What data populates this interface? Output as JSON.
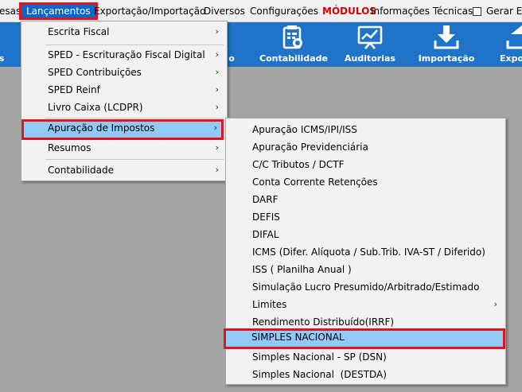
{
  "menubar": {
    "items": [
      "esas",
      "Lançamentos",
      "Exportação/Importação",
      "Diversos",
      "Configurações",
      "MÓDULOS",
      "Informações Técnicas"
    ],
    "checkbox_label": "Gerar Em"
  },
  "toolbar": {
    "partial_left": "s",
    "partial_mid": "o",
    "contabilidade": "Contabilidade",
    "auditorias": "Auditorias",
    "importacao": "Importação",
    "partial_right": "Expo"
  },
  "menu_lancamentos": {
    "items": [
      {
        "label": "Escrita Fiscal",
        "arrow": "›"
      },
      {
        "label": "SPED - Escrituração Fiscal Digital",
        "arrow": "›"
      },
      {
        "label": "SPED Contribuições",
        "arrow": "›"
      },
      {
        "label": "SPED Reinf",
        "arrow": "›"
      },
      {
        "label": "Livro Caixa (LCDPR)",
        "arrow": "›"
      },
      {
        "label": "Apuração de Impostos",
        "arrow": "›"
      },
      {
        "label": "Resumos",
        "arrow": "›"
      },
      {
        "label": "Contabilidade",
        "arrow": "›"
      }
    ]
  },
  "menu_apuracao": {
    "items": [
      {
        "label": "Apuração ICMS/IPI/ISS"
      },
      {
        "label": "Apuração Previdenciária"
      },
      {
        "label": "C/C Tributos / DCTF"
      },
      {
        "label": "Conta Corrente Retenções"
      },
      {
        "label": "DARF"
      },
      {
        "label": "DEFIS"
      },
      {
        "label": "DIFAL"
      },
      {
        "label": "ICMS (Difer. Alíquota / Sub.Trib. IVA-ST / Diferido)"
      },
      {
        "label": "ISS ( Planilha Anual )"
      },
      {
        "label": "Simulação Lucro Presumido/Arbitrado/Estimado"
      },
      {
        "label": "Limites",
        "arrow": "›"
      },
      {
        "label": "Rendimento Distribuído(IRRF)"
      },
      {
        "label": "SIMPLES NACIONAL"
      },
      {
        "label": "Simples Nacional - SP (DSN)"
      },
      {
        "label": "Simples Nacional  (DESTDA)"
      }
    ]
  },
  "colors": {
    "toolbar_bg": "#1f74c9",
    "highlight": "#91c9f7",
    "active_menu": "#0a66c8",
    "callout_red": "#e0141e",
    "modulos_red": "#d40000"
  }
}
